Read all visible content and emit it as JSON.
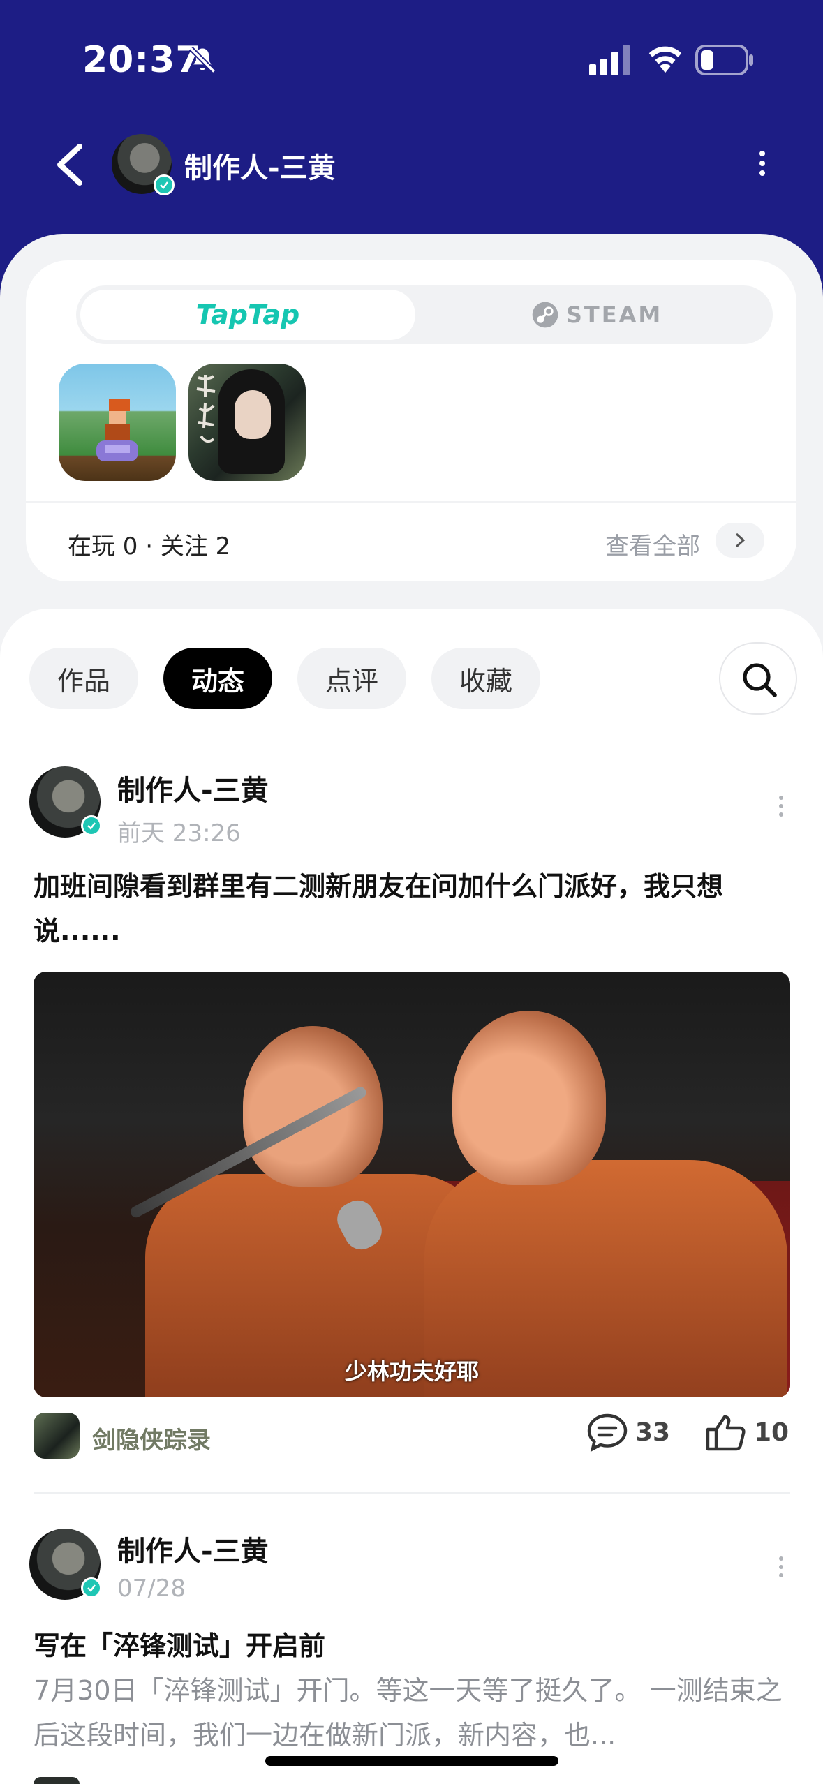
{
  "status_bar": {
    "time": "20:37"
  },
  "header": {
    "name": "制作人-三黄"
  },
  "platforms": {
    "active": "TapTap",
    "inactive": "STEAM"
  },
  "games": {
    "stats": "在玩 0 · 关注 2",
    "view_all": "查看全部"
  },
  "tabs": {
    "works": "作品",
    "posts": "动态",
    "reviews": "点评",
    "favorites": "收藏"
  },
  "posts": [
    {
      "author": "制作人-三黄",
      "time": "前天 23:26",
      "title": "加班间隙看到群里有二测新朋友在问加什么门派好，我只想说......",
      "video_caption": "少林功夫好耶",
      "game": "剑隐侠踪录",
      "comments": "33",
      "likes": "10"
    },
    {
      "author": "制作人-三黄",
      "time": "07/28",
      "title": "写在「淬锋测试」开启前",
      "excerpt": "7月30日「淬锋测试」开门。等这一天等了挺久了。 一测结束之后这段时间，我们一边在做新门派，新内容，也..."
    }
  ],
  "colors": {
    "header_bg": "#1d1d85",
    "accent": "#16c6b1",
    "verify_badge": "#1ec6b4"
  }
}
